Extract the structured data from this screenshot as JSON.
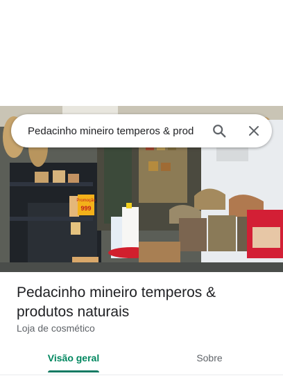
{
  "search": {
    "query": "Pedacinho mineiro temperos & prod",
    "search_icon": "search-icon",
    "close_icon": "close-icon"
  },
  "place": {
    "name": "Pedacinho mineiro temperos & produtos naturais",
    "category": "Loja de cosmético",
    "photo": "storefront-photo"
  },
  "photo_sign": {
    "line1": "Promoção",
    "line2": "999"
  },
  "tabs": [
    {
      "label": "Visão geral",
      "selected": true
    },
    {
      "label": "Sobre",
      "selected": false
    }
  ],
  "colors": {
    "accent": "#01875f",
    "indicator": "#137a63"
  }
}
